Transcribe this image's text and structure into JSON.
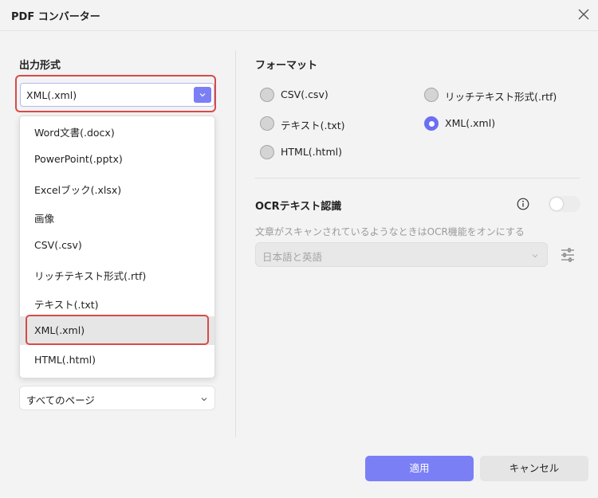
{
  "window": {
    "title": "PDF コンバーター"
  },
  "left": {
    "output_format_label": "出力形式",
    "selected_format": "XML(.xml)",
    "dropdown_options": [
      "Word文書(.docx)",
      "PowerPoint(.pptx)",
      "Excelブック(.xlsx)",
      "画像",
      "CSV(.csv)",
      "リッチテキスト形式(.rtf)",
      "テキスト(.txt)",
      "XML(.xml)",
      "HTML(.html)"
    ],
    "dropdown_selected_index": 7,
    "pages_value": "すべてのページ"
  },
  "right": {
    "format_label": "フォーマット",
    "formats": [
      {
        "label": "CSV(.csv)",
        "checked": false
      },
      {
        "label": "リッチテキスト形式(.rtf)",
        "checked": false
      },
      {
        "label": "テキスト(.txt)",
        "checked": false
      },
      {
        "label": "XML(.xml)",
        "checked": true
      },
      {
        "label": "HTML(.html)",
        "checked": false
      }
    ],
    "ocr_label": "OCRテキスト認識",
    "ocr_enabled": false,
    "ocr_description": "文章がスキャンされているようなときはOCR機能をオンにする",
    "ocr_language": "日本語と英語"
  },
  "footer": {
    "apply_label": "適用",
    "cancel_label": "キャンセル"
  },
  "colors": {
    "accent": "#7b7ff6",
    "highlight": "#d84a4a"
  }
}
